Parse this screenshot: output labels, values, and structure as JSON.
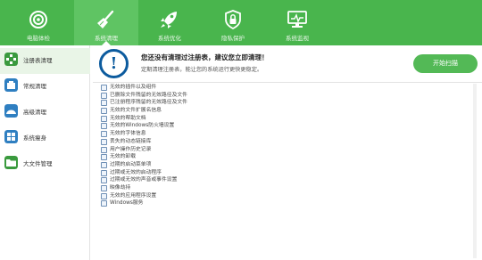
{
  "toolbar": {
    "items": [
      {
        "label": "电脑体检",
        "icon": "checkup-target-icon"
      },
      {
        "label": "系统清理",
        "icon": "broom-icon"
      },
      {
        "label": "系统优化",
        "icon": "rocket-icon"
      },
      {
        "label": "隐私保护",
        "icon": "lock-shield-icon"
      },
      {
        "label": "系统监视",
        "icon": "monitor-icon"
      }
    ],
    "active_index": 1,
    "bg_color": "#49b54d"
  },
  "sidebar": {
    "items": [
      {
        "label": "注册表清理",
        "icon": "registry-icon",
        "color": "#3a9a3e"
      },
      {
        "label": "常规清理",
        "icon": "regular-clean-icon",
        "color": "#2f7fc1"
      },
      {
        "label": "高级清理",
        "icon": "advanced-clean-icon",
        "color": "#2f7fc1"
      },
      {
        "label": "系统瘦身",
        "icon": "windows-slim-icon",
        "color": "#2f7fc1"
      },
      {
        "label": "大文件管理",
        "icon": "large-file-folder-icon",
        "color": "#3a9a3e"
      }
    ],
    "active_index": 0
  },
  "header": {
    "title": "您还没有清理过注册表，建议您立即清理！",
    "subtitle": "定期清理注册表，能让您的系统运行更快更稳定。",
    "scan_button": "开始扫描"
  },
  "list": {
    "items": [
      "无效的插件以及组件",
      "已删除文件残留的无效路径及文件",
      "已注册程序残留的无效路径及文件",
      "无效的文件扩展名信息",
      "无效的帮助文档",
      "无效的Windows防火墙设置",
      "无效的字体信息",
      "丢失的动态链接库",
      "用户操作历史记录",
      "无效的卸载",
      "过期的启动菜单项",
      "过期或无效的启动程序",
      "过期或无效的声音或事件设置",
      "映像劫持",
      "无效的应用程序设置",
      "Windows服务"
    ]
  }
}
